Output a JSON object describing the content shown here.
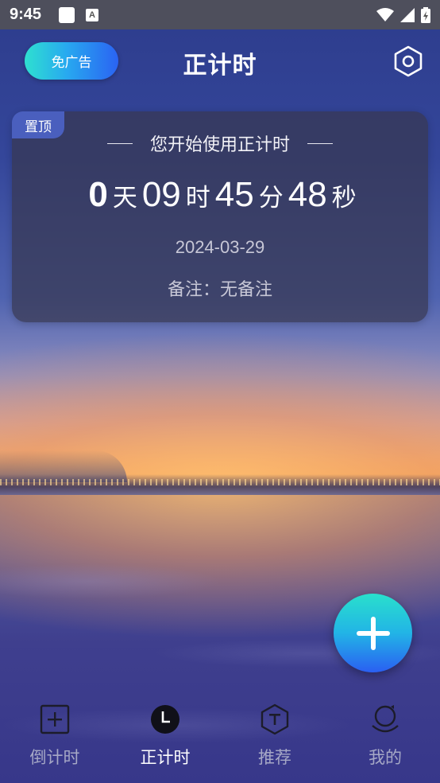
{
  "status_bar": {
    "time": "9:45",
    "icons": [
      "notification-square-icon",
      "a-notification-icon",
      "wifi-icon",
      "signal-icon",
      "battery-icon"
    ]
  },
  "header": {
    "no_ads_label": "免广告",
    "title": "正计时",
    "settings_icon": "settings-hexagon-icon"
  },
  "card": {
    "pin_label": "置顶",
    "subtitle": "您开始使用正计时",
    "days": "0",
    "days_unit": "天",
    "hours": "09",
    "hours_unit": "时",
    "minutes": "45",
    "minutes_unit": "分",
    "seconds": "48",
    "seconds_unit": "秒",
    "date": "2024-03-29",
    "note": "备注：无备注"
  },
  "fab": {
    "icon": "plus-icon"
  },
  "tabs": [
    {
      "label": "倒计时",
      "icon": "square-plus-icon",
      "active": false
    },
    {
      "label": "正计时",
      "icon": "clock-icon",
      "active": true
    },
    {
      "label": "推荐",
      "icon": "hexagon-t-icon",
      "active": false
    },
    {
      "label": "我的",
      "icon": "user-icon",
      "active": false
    }
  ],
  "colors": {
    "accent_start": "#2ee0d0",
    "accent_end": "#2a63f2",
    "pin_badge": "#4a5fbe",
    "inactive_tab": "#a6a8c6"
  }
}
